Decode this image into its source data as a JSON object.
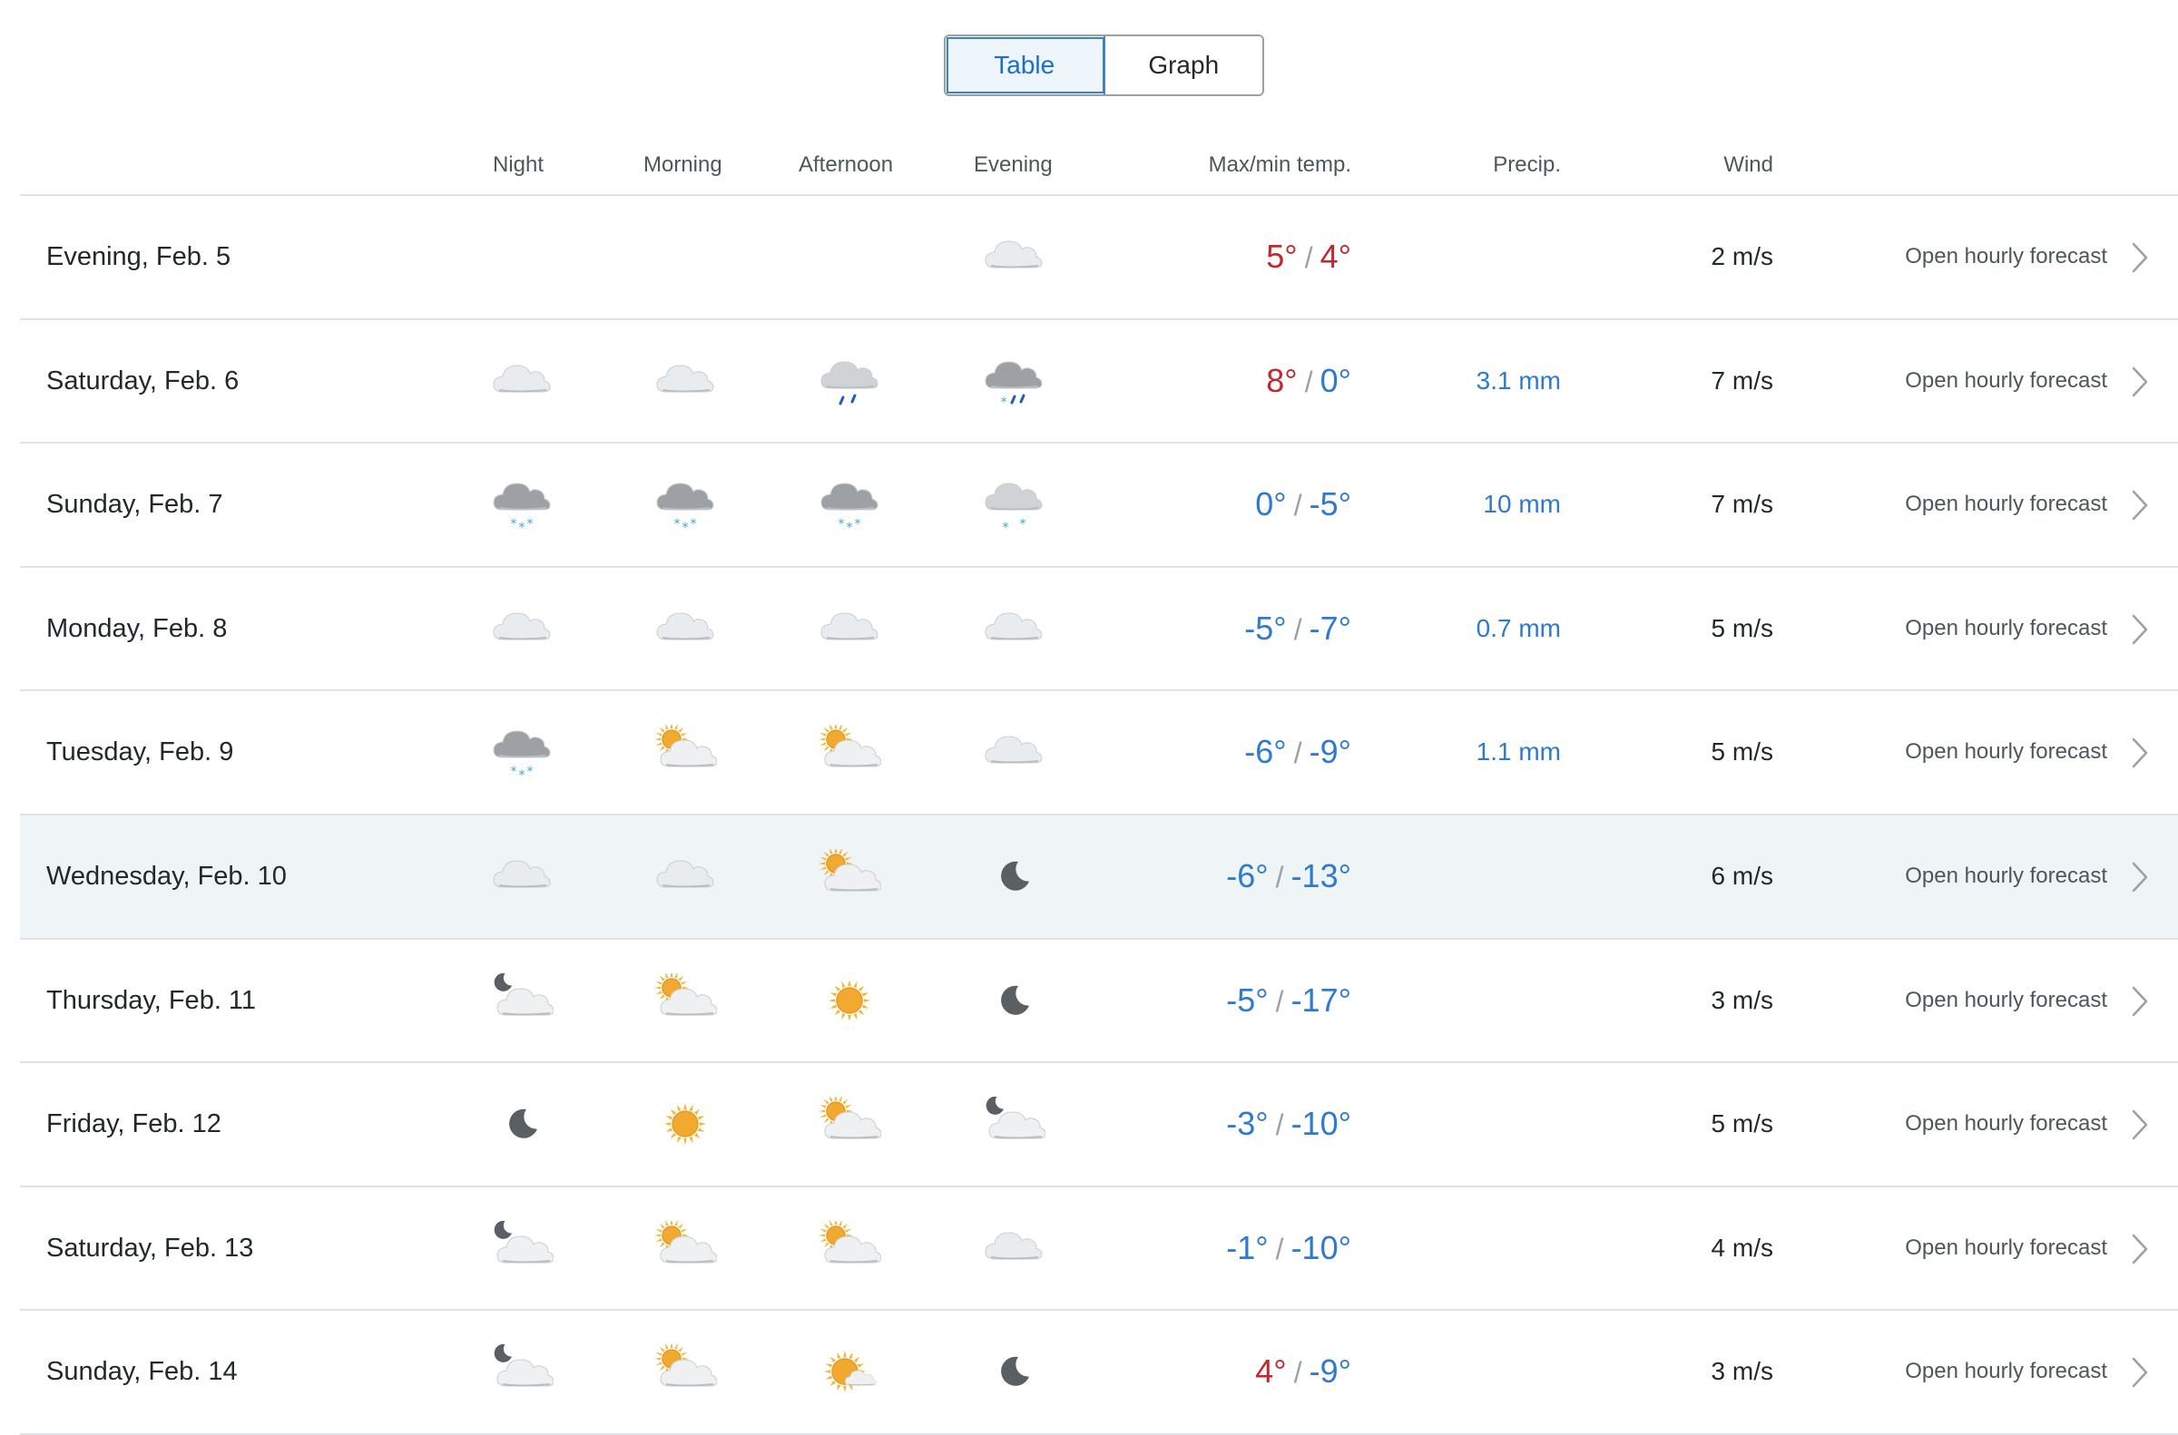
{
  "view_toggle": {
    "table_label": "Table",
    "graph_label": "Graph",
    "active": "table"
  },
  "columns": {
    "night": "Night",
    "morning": "Morning",
    "afternoon": "Afternoon",
    "evening": "Evening",
    "maxmin": "Max/min temp.",
    "precip": "Precip.",
    "wind": "Wind"
  },
  "link_label": "Open hourly forecast",
  "colors": {
    "warm": "#c2272d",
    "cold": "#2e7ad1",
    "highlight": "#eff5f7"
  },
  "rows": [
    {
      "date": "Evening, Feb. 5",
      "symbols": [
        "",
        "",
        "",
        "cloudy"
      ],
      "max": "5°",
      "min": "4°",
      "max_warm": true,
      "min_warm": true,
      "precip": "",
      "wind": "2 m/s",
      "highlight": false
    },
    {
      "date": "Saturday, Feb. 6",
      "symbols": [
        "cloudy",
        "cloudy",
        "light-rain",
        "sleet"
      ],
      "max": "8°",
      "min": "0°",
      "max_warm": true,
      "min_warm": false,
      "precip": "3.1 mm",
      "wind": "7 m/s",
      "highlight": false
    },
    {
      "date": "Sunday, Feb. 7",
      "symbols": [
        "snow",
        "snow",
        "snow",
        "light-snow"
      ],
      "max": "0°",
      "min": "-5°",
      "max_warm": false,
      "min_warm": false,
      "precip": "10 mm",
      "wind": "7 m/s",
      "highlight": false
    },
    {
      "date": "Monday, Feb. 8",
      "symbols": [
        "cloudy",
        "cloudy",
        "cloudy",
        "cloudy"
      ],
      "max": "-5°",
      "min": "-7°",
      "max_warm": false,
      "min_warm": false,
      "precip": "0.7 mm",
      "wind": "5 m/s",
      "highlight": false
    },
    {
      "date": "Tuesday, Feb. 9",
      "symbols": [
        "snow",
        "partly-cloudy-day",
        "partly-cloudy-day",
        "cloudy"
      ],
      "max": "-6°",
      "min": "-9°",
      "max_warm": false,
      "min_warm": false,
      "precip": "1.1 mm",
      "wind": "5 m/s",
      "highlight": false
    },
    {
      "date": "Wednesday, Feb. 10",
      "symbols": [
        "cloudy",
        "cloudy",
        "partly-cloudy-day",
        "clear-night"
      ],
      "max": "-6°",
      "min": "-13°",
      "max_warm": false,
      "min_warm": false,
      "precip": "",
      "wind": "6 m/s",
      "highlight": true
    },
    {
      "date": "Thursday, Feb. 11",
      "symbols": [
        "partly-cloudy-night",
        "partly-cloudy-day",
        "clear-day",
        "clear-night"
      ],
      "max": "-5°",
      "min": "-17°",
      "max_warm": false,
      "min_warm": false,
      "precip": "",
      "wind": "3 m/s",
      "highlight": false
    },
    {
      "date": "Friday, Feb. 12",
      "symbols": [
        "clear-night",
        "clear-day",
        "partly-cloudy-day",
        "partly-cloudy-night"
      ],
      "max": "-3°",
      "min": "-10°",
      "max_warm": false,
      "min_warm": false,
      "precip": "",
      "wind": "5 m/s",
      "highlight": false
    },
    {
      "date": "Saturday, Feb. 13",
      "symbols": [
        "partly-cloudy-night",
        "partly-cloudy-day",
        "partly-cloudy-day",
        "cloudy"
      ],
      "max": "-1°",
      "min": "-10°",
      "max_warm": false,
      "min_warm": false,
      "precip": "",
      "wind": "4 m/s",
      "highlight": false
    },
    {
      "date": "Sunday, Feb. 14",
      "symbols": [
        "partly-cloudy-night",
        "partly-cloudy-day",
        "fair-day",
        "clear-night"
      ],
      "max": "4°",
      "min": "-9°",
      "max_warm": true,
      "min_warm": false,
      "precip": "",
      "wind": "3 m/s",
      "highlight": false
    }
  ]
}
